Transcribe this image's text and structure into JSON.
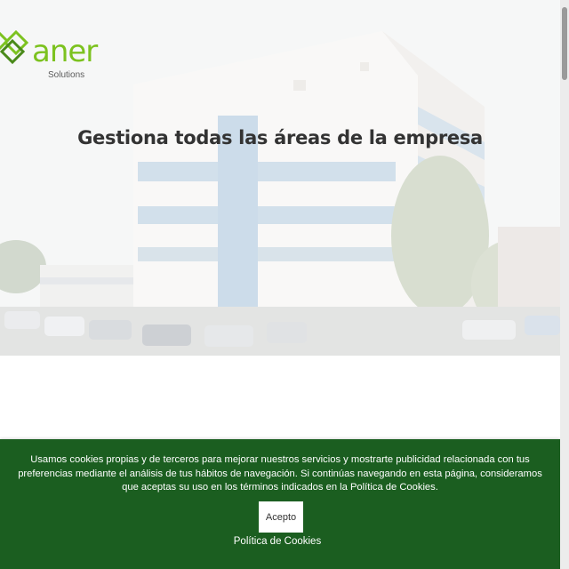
{
  "hero": {
    "logo": {
      "word": "aner",
      "sub": "Solutions",
      "color": "#7cc21f"
    },
    "title": "Gestiona todas las áreas de la empresa"
  },
  "cookie_banner": {
    "background_color": "#1b5e20",
    "message": "Usamos cookies propias y de terceros para mejorar nuestros servicios y mostrarte publicidad relacionada con tus preferencias mediante el análisis de tus hábitos de navegación. Si continúas navegando en esta página, consideramos que aceptas su uso en los términos indicados en la Política de Cookies.",
    "accept_label": "Acepto",
    "policy_link_label": "Política de Cookies"
  }
}
